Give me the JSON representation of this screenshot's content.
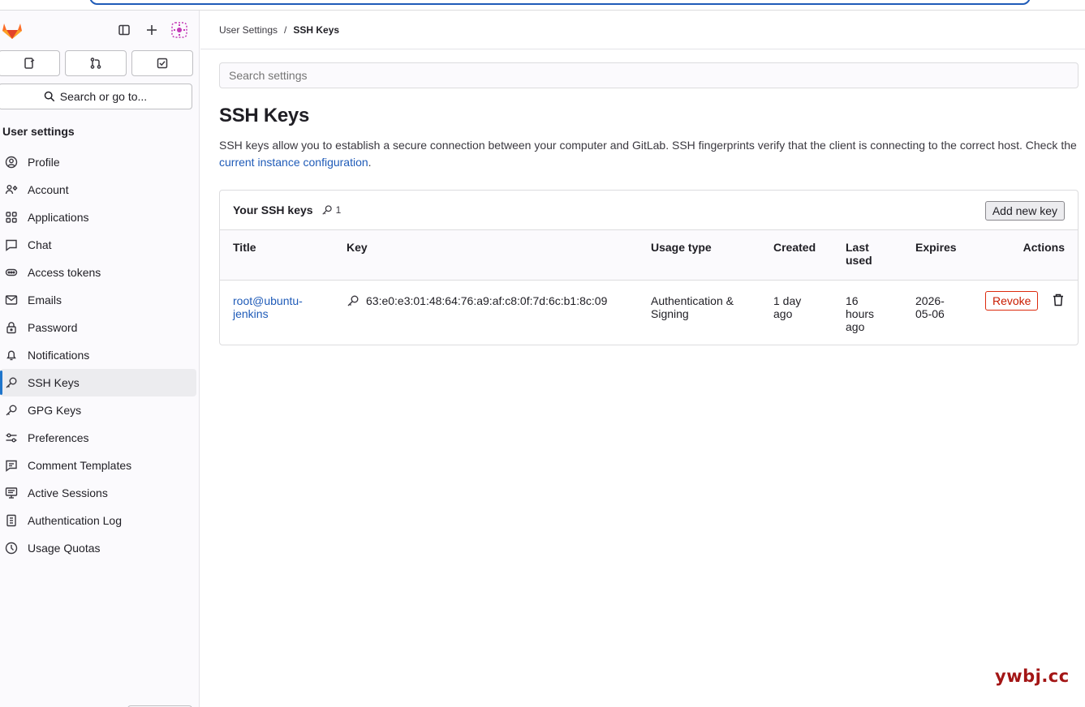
{
  "sidebar": {
    "search_label": "Search or go to...",
    "heading": "User settings",
    "items": [
      {
        "label": "Profile",
        "icon": "profile-icon"
      },
      {
        "label": "Account",
        "icon": "account-icon"
      },
      {
        "label": "Applications",
        "icon": "applications-icon"
      },
      {
        "label": "Chat",
        "icon": "chat-icon"
      },
      {
        "label": "Access tokens",
        "icon": "token-icon"
      },
      {
        "label": "Emails",
        "icon": "mail-icon"
      },
      {
        "label": "Password",
        "icon": "lock-icon"
      },
      {
        "label": "Notifications",
        "icon": "bell-icon"
      },
      {
        "label": "SSH Keys",
        "icon": "key-icon",
        "active": true
      },
      {
        "label": "GPG Keys",
        "icon": "key-icon"
      },
      {
        "label": "Preferences",
        "icon": "preferences-icon"
      },
      {
        "label": "Comment Templates",
        "icon": "comment-icon"
      },
      {
        "label": "Active Sessions",
        "icon": "monitor-icon"
      },
      {
        "label": "Authentication Log",
        "icon": "log-icon"
      },
      {
        "label": "Usage Quotas",
        "icon": "quota-icon"
      }
    ]
  },
  "breadcrumb": {
    "parent": "User Settings",
    "separator": "/",
    "current": "SSH Keys"
  },
  "search": {
    "placeholder": "Search settings"
  },
  "page": {
    "title": "SSH Keys",
    "description_before": "SSH keys allow you to establish a secure connection between your computer and GitLab. SSH fingerprints verify that the client is connecting to the correct host. Check the ",
    "description_link": "current instance configuration",
    "description_after": "."
  },
  "keys_card": {
    "title": "Your SSH keys",
    "count": "1",
    "add_button": "Add new key",
    "columns": {
      "title": "Title",
      "key": "Key",
      "usage_type": "Usage type",
      "created": "Created",
      "last_used": "Last used",
      "expires": "Expires",
      "actions": "Actions"
    },
    "rows": [
      {
        "title": "root@ubuntu-jenkins",
        "key": "63:e0:e3:01:48:64:76:a9:af:c8:0f:7d:6c:b1:8c:09",
        "usage_type": "Authentication & Signing",
        "created": "1 day ago",
        "last_used": "16 hours ago",
        "expires": "2026-05-06",
        "revoke_label": "Revoke"
      }
    ]
  },
  "watermark": "ywbj.cc",
  "colors": {
    "link": "#1f5bb8",
    "danger": "#dd2b0e",
    "active_indicator": "#1f75cb",
    "gitlab_orange": "#fc6d26"
  }
}
